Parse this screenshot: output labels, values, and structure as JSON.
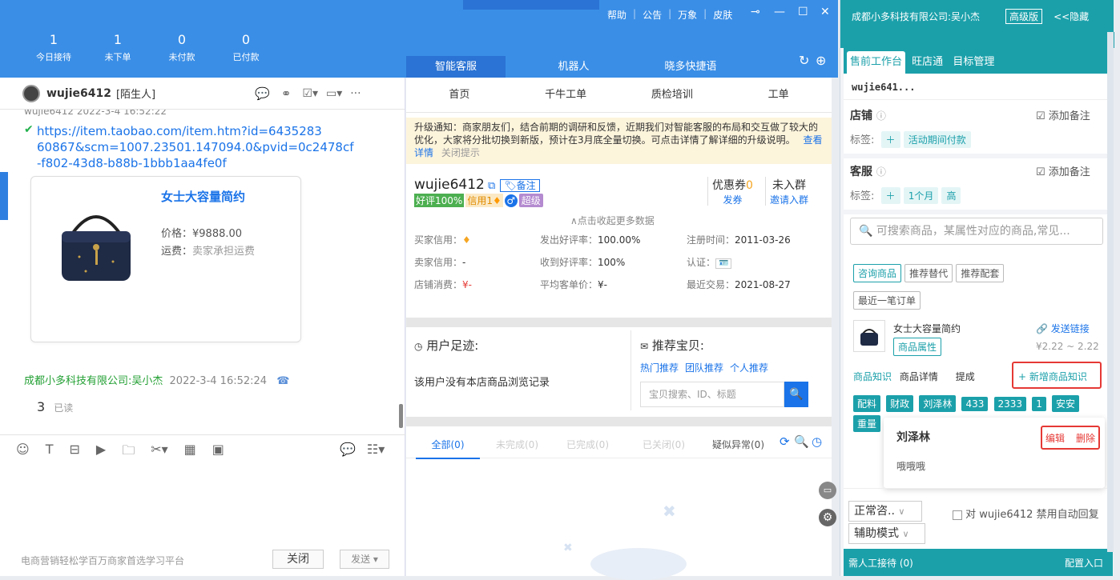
{
  "stats": [
    {
      "value": "1",
      "label": "今日接待"
    },
    {
      "value": "1",
      "label": "未下单"
    },
    {
      "value": "0",
      "label": "未付款"
    },
    {
      "value": "0",
      "label": "已付款"
    }
  ],
  "topmenu": [
    "帮助",
    "公告",
    "万象",
    "皮肤"
  ],
  "main_tabs": [
    "智能客服",
    "机器人",
    "晓多快捷语"
  ],
  "chat": {
    "contact_name": "wujie6412",
    "contact_tag": "[陌生人]",
    "message_header": "wujie6412 2022-3-4 16:52:22",
    "link_text": "https://item.taobao.com/item.htm?id=643528360867&scm=1007.23501.147094.0&pvid=0c2478cf-f802-43d8-b88b-1bbb1aa4fe0f",
    "link_line1": "https://item.taobao.com/item.htm?id=6435283",
    "link_line2": "60867&scm=1007.23501.147094.0&pvid=0c2478cf",
    "link_line3": "-f802-43d8-b88b-1bbb1aa4fe0f",
    "product_title": "女士大容量简约",
    "price_label": "价格：",
    "price": "¥9888.00",
    "ship_label": "运费：",
    "ship_value": "卖家承担运费",
    "agent_name": "成都小多科技有限公司:吴小杰",
    "agent_time": "2022-3-4 16:52:24",
    "reply_text": "3",
    "read_status": "已读",
    "footer_ad": "电商营销轻松学百万商家首选学习平台",
    "close_btn": "关闭",
    "send_btn": "发送"
  },
  "mid": {
    "subtabs": [
      "首页",
      "千牛工单",
      "质检培训",
      "工单"
    ],
    "notice_text": "升级通知：商家朋友们，结合前期的调研和反馈，近期我们对智能客服的布局和交互做了较大的优化，大家将分批切换到新版，预计在3月底全量切换。可点击详情了解详细的升级说明。",
    "notice_link": "查看详情",
    "notice_close": "关闭提示",
    "buyer_name": "wujie6412",
    "note_btn": "备注",
    "good_rate": "好评100%",
    "credit": "信用1",
    "super": "超级",
    "coupon_label": "优惠券",
    "coupon_count": "0",
    "coupon_action": "发券",
    "group_label": "未入群",
    "group_action": "邀请入群",
    "collapse": "∧点击收起更多数据",
    "rows": [
      [
        "买家信用：",
        "",
        "发出好评率：",
        "100.00%",
        "注册时间：",
        "2011-03-26"
      ],
      [
        "卖家信用：",
        "-",
        "收到好评率：",
        "100%",
        "认证：",
        ""
      ],
      [
        "店铺消费：",
        "¥-",
        "平均客单价：",
        "¥-",
        "最近交易：",
        "2021-08-27"
      ]
    ],
    "footprint_title": "用户足迹:",
    "footprint_empty": "该用户没有本店商品浏览记录",
    "recommend_title": "推荐宝贝:",
    "recommend_links": [
      "热门推荐",
      "团队推荐",
      "个人推荐"
    ],
    "recommend_search_placeholder": "宝贝搜索、ID、标题",
    "order_tabs": [
      "全部(0)",
      "未完成(0)",
      "已完成(0)",
      "已关闭(0)",
      "疑似异常(0)"
    ]
  },
  "right": {
    "company": "成都小多科技有限公司:吴小杰",
    "edition": "高级版",
    "hide": "<<隐藏",
    "tabs": [
      "售前工作台",
      "旺店通",
      "目标管理"
    ],
    "customer_id": "wujie641...",
    "shop_label": "店铺",
    "add_note": "添加备注",
    "tag_label": "标签:",
    "shop_tags": [
      "活动期间付款"
    ],
    "service_label": "客服",
    "service_tags": [
      "1个月",
      "高"
    ],
    "search_placeholder": "可搜索商品，某属性对应的商品,常见...",
    "product_buttons": [
      "咨询商品",
      "推荐替代",
      "推荐配套",
      "最近一笔订单"
    ],
    "product_name": "女士大容量简约",
    "product_attr_btn": "商品属性",
    "send_link": "发送链接",
    "product_price": "¥2.22 ~ 2.22",
    "knowledge_tabs": [
      "商品知识",
      "商品详情",
      "提成"
    ],
    "add_knowledge": "+ 新增商品知识",
    "knowledge_tags": [
      "配料",
      "财政",
      "刘泽林",
      "433",
      "2333",
      "1",
      "安安",
      "重量"
    ],
    "popup_name": "刘泽林",
    "popup_text": "哦哦哦",
    "edit": "编辑",
    "delete": "删除",
    "mode_select": "正常咨..",
    "auto_reply_label": "对 wujie6412 禁用自动回复",
    "assist_mode": "辅助模式",
    "footer_left": "需人工接待 (0)",
    "footer_right": "配置入口"
  }
}
